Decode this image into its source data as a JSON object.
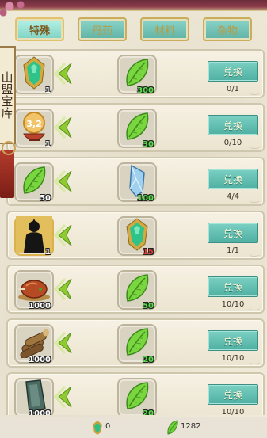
{
  "tabs": [
    {
      "label": "特殊",
      "active": true
    },
    {
      "label": "丹药",
      "active": false
    },
    {
      "label": "材料",
      "active": false
    },
    {
      "label": "杂物",
      "active": false
    }
  ],
  "banner": {
    "text": "山盟宝库"
  },
  "exchange_label": "兑换",
  "rows": [
    {
      "give": {
        "icon": "jade-ornament-icon",
        "count": "1",
        "count_color": "white"
      },
      "get": {
        "icon": "green-leaf-icon",
        "count": "300",
        "count_color": "green"
      },
      "limit": "0/1"
    },
    {
      "give": {
        "icon": "pill-bowl-icon",
        "count": "1",
        "count_color": "white"
      },
      "get": {
        "icon": "green-leaf-icon",
        "count": "30",
        "count_color": "green"
      },
      "limit": "0/10"
    },
    {
      "give": {
        "icon": "green-leaf-icon",
        "count": "50",
        "count_color": "white"
      },
      "get": {
        "icon": "blue-crystal-icon",
        "count": "100",
        "count_color": "green"
      },
      "limit": "4/4"
    },
    {
      "give": {
        "icon": "character-silhouette-icon",
        "count": "1",
        "count_color": "white"
      },
      "get": {
        "icon": "jade-ornament-icon",
        "count": "15",
        "count_color": "red"
      },
      "limit": "1/1"
    },
    {
      "give": {
        "icon": "roast-meat-icon",
        "count": "1000",
        "count_color": "white"
      },
      "get": {
        "icon": "green-leaf-icon",
        "count": "50",
        "count_color": "green"
      },
      "limit": "10/10"
    },
    {
      "give": {
        "icon": "wood-logs-icon",
        "count": "1000",
        "count_color": "white"
      },
      "get": {
        "icon": "green-leaf-icon",
        "count": "20",
        "count_color": "green"
      },
      "limit": "10/10"
    },
    {
      "give": {
        "icon": "stone-slab-icon",
        "count": "1000",
        "count_color": "white"
      },
      "get": {
        "icon": "green-leaf-icon",
        "count": "20",
        "count_color": "green"
      },
      "limit": "10/10"
    }
  ],
  "footer": {
    "jade_count": "0",
    "leaf_count": "1282"
  },
  "colors": {
    "accent_teal": "#5fb3a6",
    "gold": "#c9ad5c",
    "leaf_green": "#6fcf3a"
  }
}
